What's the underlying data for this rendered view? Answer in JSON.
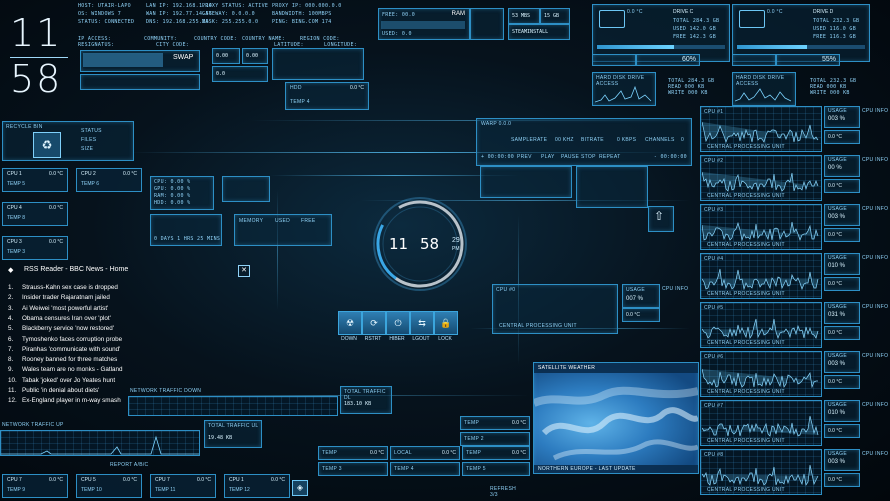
{
  "clock": {
    "hour": "11",
    "minute": "58",
    "seconds": "29",
    "ampm": "PM"
  },
  "network": {
    "host": "HOST: UTAIR-LAPO",
    "os": "OS: WINDOWS 7",
    "status": "STATUS: CONNECTED",
    "lan_ip": "LAN IP: 192.168.1.14",
    "wan_ip": "WAN IP: 192.77.14.56",
    "dns": "DNS: 192.168.255.26",
    "proxy": "PROXY STATUS: ACTIVE",
    "gateway": "GATEWAY: 0.0.0.0",
    "mask": "MASK: 255.255.0.0",
    "proxy_ip": "PROXY IP: 000.000.0.0",
    "bandwidth": "BANDWIDTH: 100MBPS",
    "ping": "PING: BING.COM 174"
  },
  "location": {
    "header_labels": [
      "IP ACCESS:",
      "COMMUNITY:",
      "COUNTRY CODE:",
      "COUNTRY NAME:",
      "REGION CODE:"
    ],
    "row_labels": [
      "RESIGNATUS:",
      "CITY CODE:",
      "LATITUDE:",
      "LONGITUDE:"
    ]
  },
  "swap": {
    "label": "SWAP",
    "values": [
      "0.00",
      "0.00",
      "0.0"
    ]
  },
  "ram": {
    "label": "RAM",
    "free": "FREE: 00.0",
    "used": "USED: 0.0"
  },
  "network_boxes": [
    "53 MBS",
    "15 GB",
    "STEAMINSTALL"
  ],
  "drives": [
    {
      "name": "DRIVE C",
      "temp": "0.0 °C",
      "total": "TOTAL 284.3 GB",
      "used": "USED 142.0 GB",
      "free": "FREE 142.3 GB",
      "percent": "60%",
      "read": "READ 000 KB",
      "write": "WRITE 000 KB",
      "label": "HARD DISK DRIVE ACCESS"
    },
    {
      "name": "DRIVE D",
      "temp": "0.0 °C",
      "total": "TOTAL 232.3 GB",
      "used": "USED 116.0 GB",
      "free": "FREE 116.3 GB",
      "percent": "55%",
      "read": "READ 000 KB",
      "write": "WRITE 000 KB",
      "label": "HARD DISK DRIVE ACCESS"
    }
  ],
  "recycle": {
    "title": "RECYCLE BIN",
    "status": "STATUS",
    "files": "FILES",
    "size": "SIZE"
  },
  "hdd": {
    "label": "HDD",
    "temp": "0.0 °C",
    "sub": "TEMP 4"
  },
  "cpu_boxes_left": [
    {
      "name": "CPU 1",
      "temp": "0.0 °C",
      "sub": "TEMP 5"
    },
    {
      "name": "CPU 4",
      "temp": "0.0 °C",
      "sub": "TEMP 8"
    },
    {
      "name": "CPU 3",
      "temp": "0.0 °C",
      "sub": "TEMP 3"
    }
  ],
  "cpu_box_mid": {
    "name": "CPU 2",
    "temp": "0.0 °C",
    "sub": "TEMP 6"
  },
  "center_stats": {
    "cpu_lines": [
      "CPU: 0.00 %",
      "GPU: 0.00 %",
      "RAM: 0.00 %",
      "HDD: 0.00 %"
    ],
    "uptime": "0 DAYS 1 HRS 25 MINS",
    "memory_table": [
      "MEMORY",
      "USED",
      "FREE"
    ]
  },
  "player": {
    "track": "WARP 0.0.0",
    "sample_rate": "SAMPLERATE",
    "rate": "00 KHZ",
    "bitrate": "BITRATE",
    "kbps": "0 KBPS",
    "channels": "CHANNELS",
    "ch": "0",
    "time_left": "+ 00:00:00",
    "time_right": "- 00:00:00",
    "controls": [
      "PREV",
      "PLAY",
      "PAUSE",
      "STOP",
      "REPEAT"
    ]
  },
  "cpu0": {
    "name": "CPU #0",
    "label": "CENTRAL PROCESSING UNIT",
    "usage_label": "USAGE",
    "usage": "007 %",
    "temp": "0.0 °C",
    "info": "CPU INFO"
  },
  "system_buttons": [
    {
      "label": "DOWN",
      "icon": "radiation-icon",
      "glyph": "☢"
    },
    {
      "label": "RSTRT",
      "icon": "restart-icon",
      "glyph": "⟳"
    },
    {
      "label": "HIBER",
      "icon": "power-icon",
      "glyph": "⏻"
    },
    {
      "label": "LGOUT",
      "icon": "swap-icon",
      "glyph": "⇆"
    },
    {
      "label": "LOCK",
      "icon": "lock-icon",
      "glyph": "🔒"
    }
  ],
  "rss": {
    "title": "RSS Reader - BBC News - Home",
    "close": "✕",
    "items": [
      "Strauss-Kahn sex case is dropped",
      "Insider trader Rajaratnam jailed",
      "Ai Weiwei 'most powerful artist'",
      "Obama censures Iran over 'plot'",
      "Blackberry service 'now restored'",
      "Tymoshenko faces corruption probe",
      "Piranhas 'communicate with sound'",
      "Rooney banned for three matches",
      "Wales team are no monks - Gatland",
      "Tabak 'joked' over Jo Yeates hunt",
      "Public 'in denial about diets'",
      "Ex-England player in m-way smash"
    ]
  },
  "traffic": {
    "down_title": "NETWORK TRAFFIC DOWN",
    "up_title": "NETWORK TRAFFIC UP",
    "total_label": "TOTAL TRAFFIC DL",
    "total_value": "183.10 KB",
    "total_up_label": "TOTAL TRAFFIC UL",
    "total_up_value": "19.48 KB"
  },
  "weather": {
    "title": "SATELLITE WEATHER",
    "caption": "NORTHERN EUROPE - LAST UPDATE"
  },
  "temp_boxes_mid": [
    {
      "name": "TEMP",
      "value": "0.0 °C"
    },
    {
      "name": "TEMP 2",
      "value": ""
    },
    {
      "name": "LOCAL",
      "value": "0.0 °C"
    },
    {
      "name": "TEMP",
      "value": "0.0 °C"
    },
    {
      "name": "TEMP 3",
      "value": ""
    },
    {
      "name": "TEMP 4",
      "value": ""
    },
    {
      "name": "TEMP",
      "value": "0.0 °C"
    },
    {
      "name": "TEMP 5",
      "value": ""
    }
  ],
  "bottom_cpus": [
    {
      "name": "CPU 7",
      "temp": "0.0 °C",
      "sub": "TEMP 9"
    },
    {
      "name": "CPU 5",
      "temp": "0.0 °C",
      "sub": "TEMP 10"
    },
    {
      "name": "CPU 7",
      "temp": "0.0 °C",
      "sub": "TEMP 11"
    },
    {
      "name": "CPU 1",
      "temp": "0.0 °C",
      "sub": "TEMP 12"
    }
  ],
  "right_cpus": [
    {
      "name": "CPU #1",
      "usage": "003 %",
      "temp": "0.0 °C"
    },
    {
      "name": "CPU #2",
      "usage": "00 %",
      "temp": "0.0 °C"
    },
    {
      "name": "CPU #3",
      "usage": "003 %",
      "temp": "0.0 °C"
    },
    {
      "name": "CPU #4",
      "usage": "010 %",
      "temp": "0.0 °C"
    },
    {
      "name": "CPU #5",
      "usage": "031 %",
      "temp": "0.0 °C"
    },
    {
      "name": "CPU #6",
      "usage": "003 %",
      "temp": "0.0 °C"
    },
    {
      "name": "CPU #7",
      "usage": "010 %",
      "temp": "0.0 °C"
    },
    {
      "name": "CPU #8",
      "usage": "003 %",
      "temp": "0.0 °C"
    }
  ],
  "right_labels": {
    "usage": "USAGE",
    "info": "CPU INFO",
    "unit": "CENTRAL PROCESSING UNIT"
  },
  "misc": {
    "report": "REPORT A/B/C",
    "refresh": "REFRESH 3/3"
  }
}
